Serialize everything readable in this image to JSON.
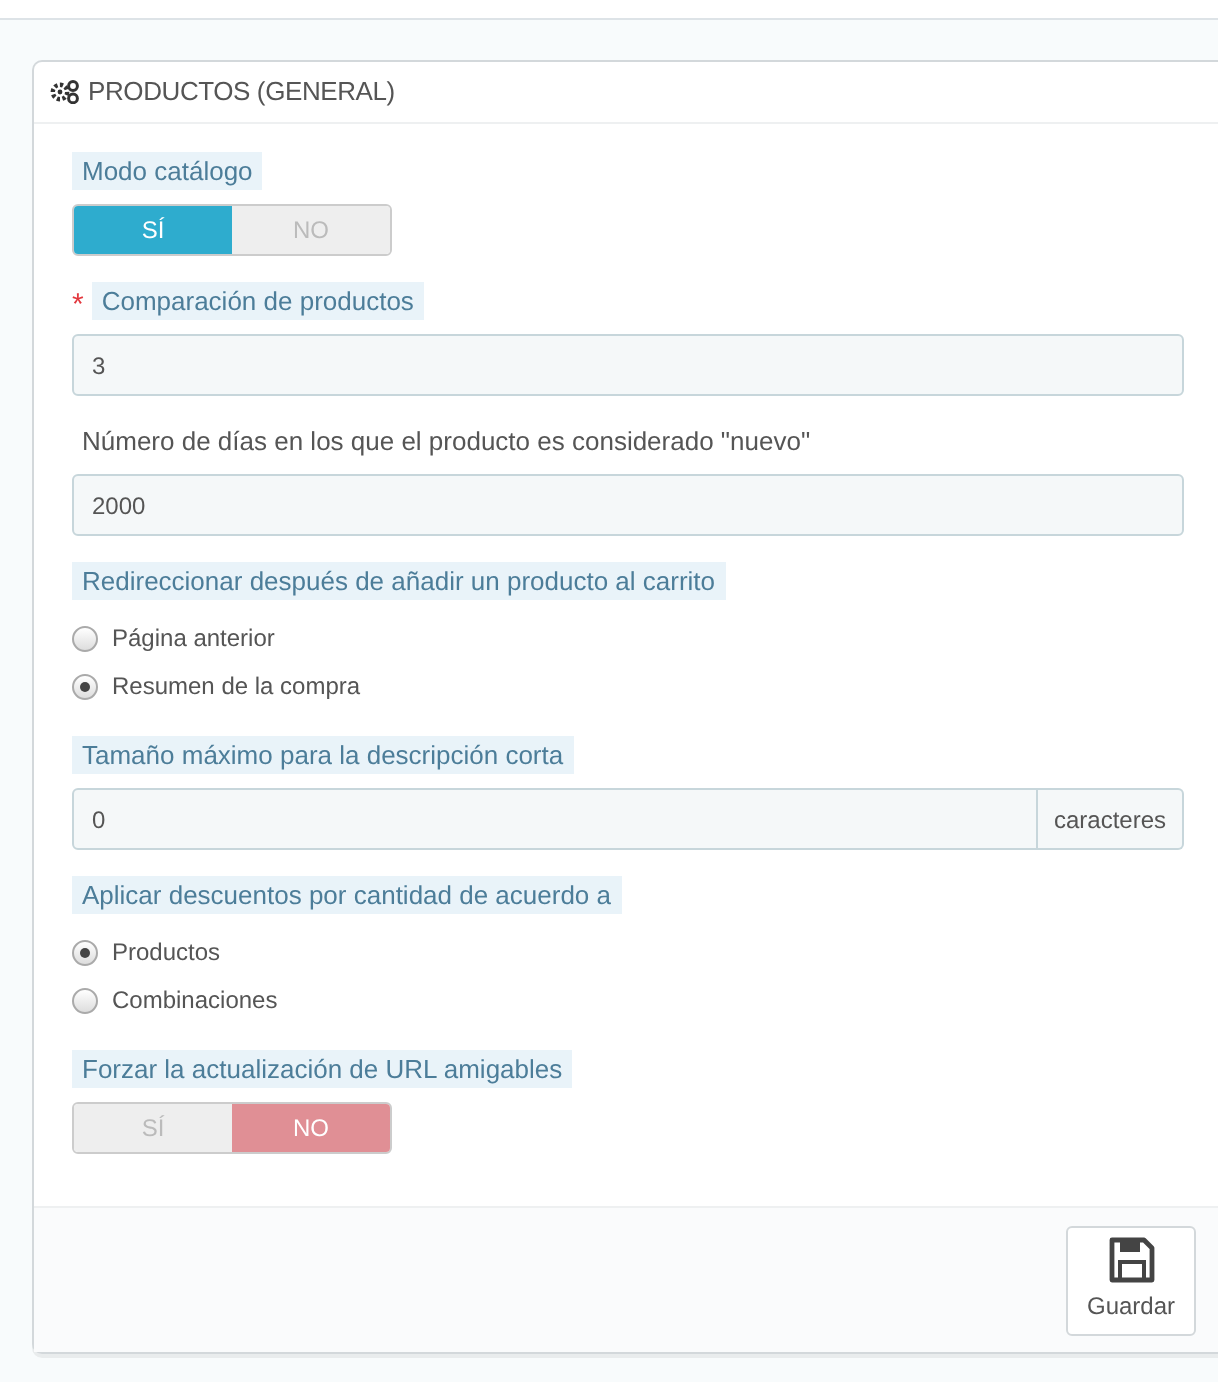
{
  "panel": {
    "title": "PRODUCTOS (GENERAL)"
  },
  "fields": [
    {
      "kind": "switch",
      "label": "Modo catálogo",
      "hint": true,
      "options": [
        {
          "label": "SÍ",
          "kind": "yes",
          "selected": true
        },
        {
          "label": "NO",
          "kind": "no",
          "selected": false
        }
      ]
    },
    {
      "kind": "input",
      "label": "Comparación de productos",
      "hint": true,
      "required_mark": "*",
      "value": "3"
    },
    {
      "kind": "input",
      "label": "Número de días en los que el producto es considerado \"nuevo\"",
      "hint": false,
      "value": "2000"
    },
    {
      "kind": "radio",
      "label": "Redireccionar después de añadir un producto al carrito",
      "hint": true,
      "options": [
        {
          "label": "Página anterior",
          "selected": false
        },
        {
          "label": "Resumen de la compra",
          "selected": true
        }
      ]
    },
    {
      "kind": "input",
      "label": "Tamaño máximo para la descripción corta",
      "hint": true,
      "value": "0",
      "addon": "caracteres"
    },
    {
      "kind": "radio",
      "label": "Aplicar descuentos por cantidad de acuerdo a",
      "hint": true,
      "options": [
        {
          "label": "Productos",
          "selected": true
        },
        {
          "label": "Combinaciones",
          "selected": false
        }
      ]
    },
    {
      "kind": "switch",
      "label": "Forzar la actualización de URL amigables",
      "hint": true,
      "options": [
        {
          "label": "SÍ",
          "kind": "yes",
          "selected": false
        },
        {
          "label": "NO",
          "kind": "no",
          "selected": true
        }
      ]
    }
  ],
  "save_button": {
    "label": "Guardar"
  }
}
